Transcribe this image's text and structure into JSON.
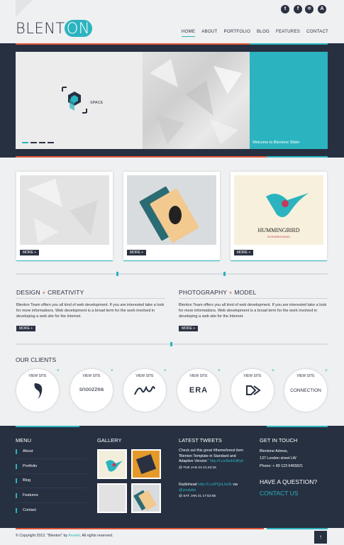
{
  "header": {
    "logo_main": "BLENT",
    "logo_on": "ON",
    "social": [
      "twitter-icon",
      "facebook-icon",
      "dribbble-icon",
      "app-icon"
    ],
    "nav": [
      "HOME",
      "ABOUT",
      "PORTFOLIO",
      "BLOG",
      "FEATURES",
      "CONTACT"
    ]
  },
  "slider": {
    "space_label": "SPACE",
    "caption": "Welcome to Blentone Slider"
  },
  "cards": [
    {
      "more": "MORE +"
    },
    {
      "more": "MORE +"
    },
    {
      "more": "MORE +",
      "title": "HUMMINGBIRD",
      "subtitle": "SCRAPBOOKING"
    }
  ],
  "sections": [
    {
      "title_a": "DESIGN",
      "plus": "+",
      "title_b": "CREATIVITY",
      "text": "Blenton Team offers you all kind of web development. If you are interested take a look for more informations. Web development is a broad term for the work involved in developing a web site for the Internet.",
      "more": "MORE +"
    },
    {
      "title_a": "PHOTOGRAPHY",
      "plus": "+",
      "title_b": "MODEL",
      "text": "Blenton Team offers you all kind of web development. If you are interested take a look for more informations. Web development is a broad term for the work involved in developing a web site for the Internet.",
      "more": "MORE +"
    }
  ],
  "clients": {
    "title": "OUR CLIENTS",
    "view": "VIEW SITE",
    "plus": "+",
    "logos": [
      "",
      "snoozzea",
      "",
      "ERA",
      "",
      "CONNECTION"
    ]
  },
  "footer": {
    "menu_title": "MENU",
    "menu": [
      "About",
      "Portfolio",
      "Blog",
      "Features",
      "Contact"
    ],
    "gallery_title": "GALLERY",
    "tweets_title": "LATEST TWEETS",
    "tweets": [
      {
        "text": "Check out this great #themeforest item 'Blenton Template in Standard and Adaptive Version '",
        "link": "http://t.co/8wbGtByh",
        "time": "@ TUE JAN 24 21:43:16"
      },
      {
        "text": "Radiohead",
        "link": "http://t.co/PQoLIw3k",
        "via": "via",
        "user": "@youtube",
        "time": "@ SAT JAN 21 17:52:55"
      }
    ],
    "contact_title": "GET IN TOUCH",
    "address_1": "Blentone Adress,",
    "address_2": "137 London street LW",
    "phone": "Phone: + 89 123 6455821",
    "question": "HAVE A QUESTION?",
    "contact_us": "CONTACT US",
    "copyright_a": "© Copyright 2012. \"Blenton\" by",
    "author": "Anariel",
    "copyright_b": ". All rights reserved."
  },
  "colors": {
    "accent": "#2bb4bf",
    "orange": "#e0563a",
    "dark": "#263041"
  }
}
